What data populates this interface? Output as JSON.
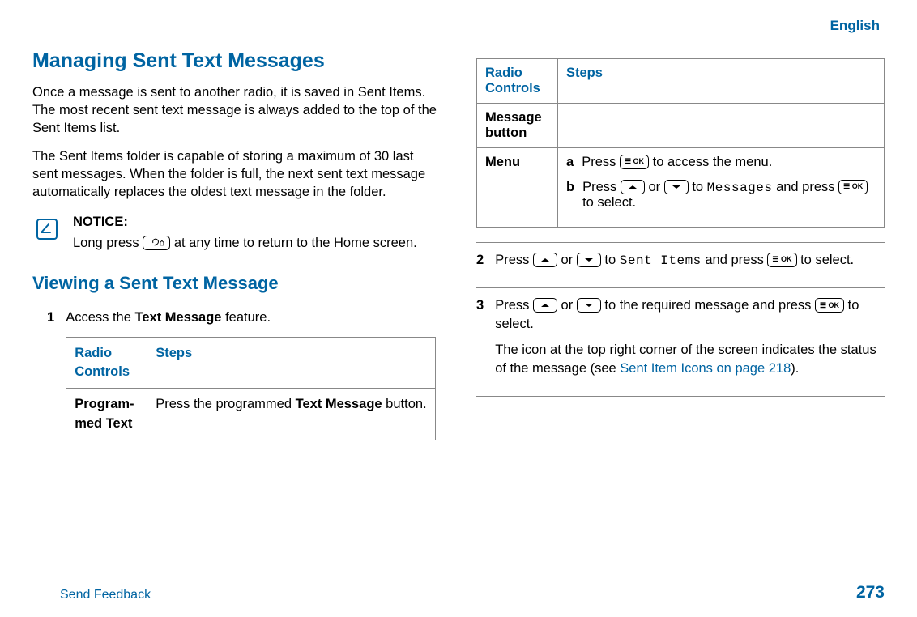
{
  "lang": "English",
  "left": {
    "h1": "Managing Sent Text Messages",
    "p1": "Once a message is sent to another radio, it is saved in Sent Items. The most recent sent text message is always added to the top of the Sent Items list.",
    "p2": "The Sent Items folder is capable of storing a maximum of 30 last sent messages. When the folder is full, the next sent text message automatically replaces the oldest text message in the folder.",
    "notice_label": "NOTICE:",
    "notice_text_before": "Long press ",
    "notice_text_after": " at any time to return to the Home screen.",
    "h2": "Viewing a Sent Text Message",
    "step1_num": "1",
    "step1_text_before": "Access the ",
    "step1_bold": "Text Message",
    "step1_text_after": " feature.",
    "table1": {
      "col1": "Radio Controls",
      "col2": "Steps",
      "row1_label": "Pro­gram­med Text",
      "row1_steps_before": "Press the programmed ",
      "row1_steps_bold": "Text Mes­sage",
      "row1_steps_after": " button."
    }
  },
  "right": {
    "table2": {
      "col1": "Radio Controls",
      "col2": "Steps",
      "row1_label": "Message button",
      "row2_label": "Menu",
      "row2_a_letter": "a",
      "row2_a_before": "Press ",
      "row2_a_after": " to access the menu.",
      "row2_b_letter": "b",
      "row2_b_before": "Press ",
      "row2_b_mid1": " or ",
      "row2_b_mid2": " to ",
      "row2_b_code": "Messag­es",
      "row2_b_mid3": " and press ",
      "row2_b_after": " to select."
    },
    "step2_num": "2",
    "step2_before": "Press ",
    "step2_mid1": " or ",
    "step2_mid2": " to ",
    "step2_code": "Sent Items",
    "step2_mid3": " and press ",
    "step2_after": " to select.",
    "step3_num": "3",
    "step3_before": "Press ",
    "step3_mid1": " or ",
    "step3_mid2": " to the required message and press ",
    "step3_after": " to select.",
    "step3_para2_before": "The icon at the top right corner of the screen indicates the status of the message (see ",
    "step3_link": "Sent Item Icons on page 218",
    "step3_para2_after": ")."
  },
  "footer": {
    "feedback": "Send Feedback",
    "page": "273"
  }
}
